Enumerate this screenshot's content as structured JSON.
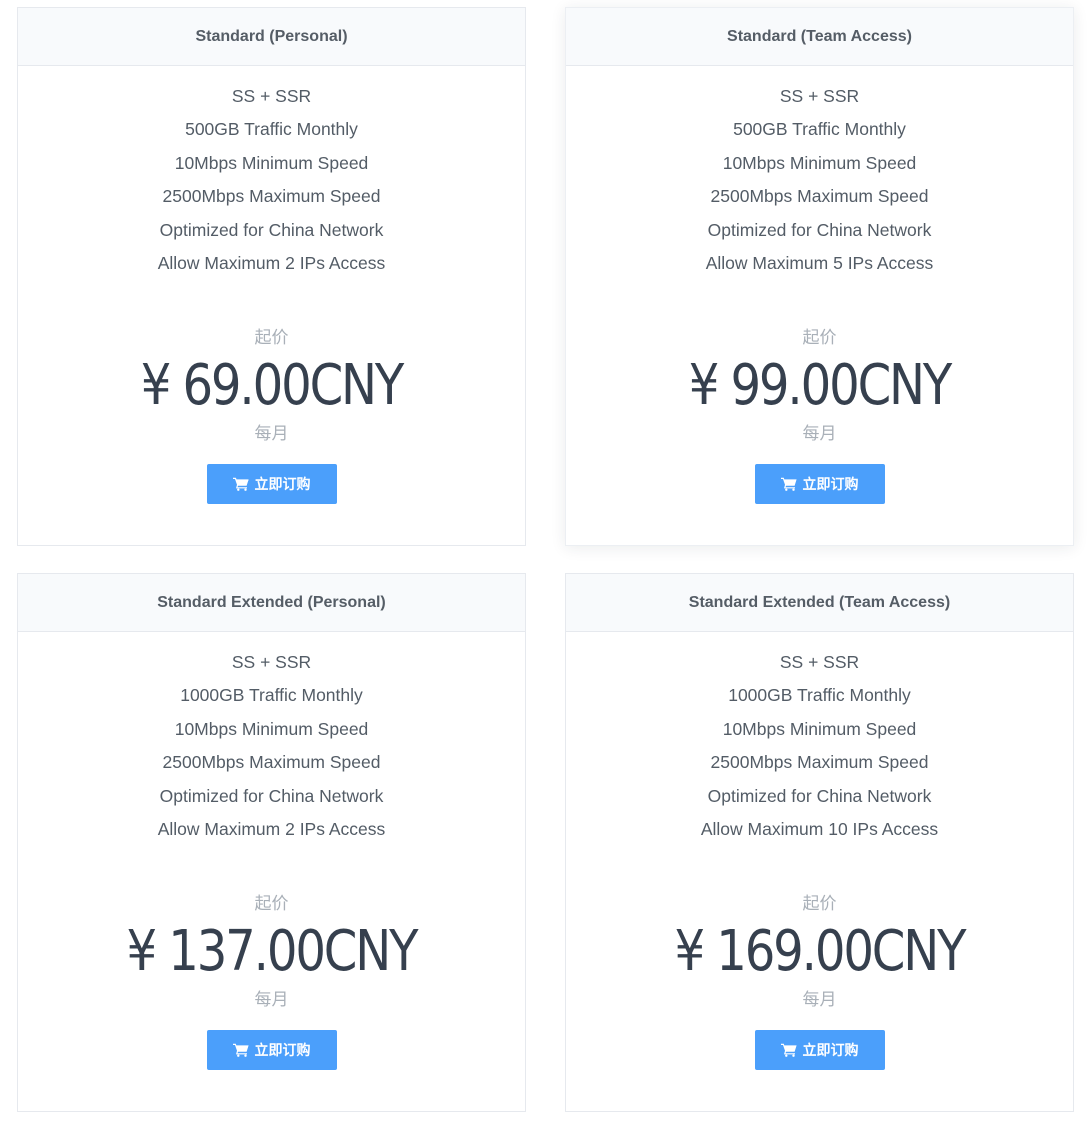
{
  "plans": [
    {
      "name": "Standard (Personal)",
      "features": [
        "SS + SSR",
        "500GB Traffic Monthly",
        "10Mbps Minimum Speed",
        "2500Mbps Maximum Speed",
        "Optimized for China Network",
        "Allow Maximum 2 IPs Access"
      ],
      "starting_label": "起价",
      "price": "¥ 69.00CNY",
      "period": "每月",
      "order_label": "立即订购"
    },
    {
      "name": "Standard (Team Access)",
      "features": [
        "SS + SSR",
        "500GB Traffic Monthly",
        "10Mbps Minimum Speed",
        "2500Mbps Maximum Speed",
        "Optimized for China Network",
        "Allow Maximum 5 IPs Access"
      ],
      "starting_label": "起价",
      "price": "¥ 99.00CNY",
      "period": "每月",
      "order_label": "立即订购"
    },
    {
      "name": "Standard Extended (Personal)",
      "features": [
        "SS + SSR",
        "1000GB Traffic Monthly",
        "10Mbps Minimum Speed",
        "2500Mbps Maximum Speed",
        "Optimized for China Network",
        "Allow Maximum 2 IPs Access"
      ],
      "starting_label": "起价",
      "price": "¥ 137.00CNY",
      "period": "每月",
      "order_label": "立即订购"
    },
    {
      "name": "Standard Extended (Team Access)",
      "features": [
        "SS + SSR",
        "1000GB Traffic Monthly",
        "10Mbps Minimum Speed",
        "2500Mbps Maximum Speed",
        "Optimized for China Network",
        "Allow Maximum 10 IPs Access"
      ],
      "starting_label": "起价",
      "price": "¥ 169.00CNY",
      "period": "每月",
      "order_label": "立即订购"
    }
  ],
  "icons": {
    "order_button_icon": "shopping-cart-icon"
  },
  "colors": {
    "button": "#4b9ffb",
    "price_text": "#36404e",
    "muted_text": "#a9b0b8",
    "header_bg": "#f8fafc"
  }
}
